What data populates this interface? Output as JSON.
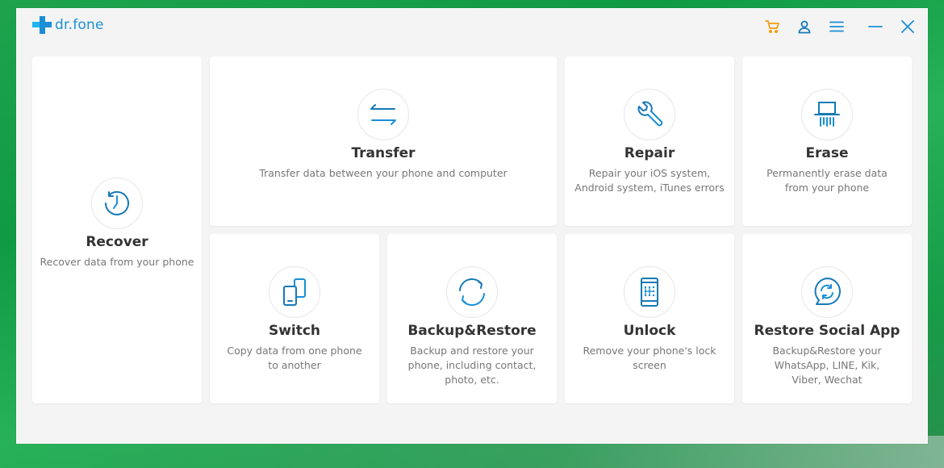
{
  "app": {
    "title": "dr.fone",
    "icons": [
      "cart-icon",
      "user-icon",
      "menu-icon",
      "minimize-icon",
      "close-icon"
    ],
    "colors": {
      "brand": "#1a8fd6",
      "cart": "#f39c12",
      "accent": "#1679b8"
    }
  },
  "modules": {
    "recover": {
      "title": "Recover",
      "desc": "Recover data from your phone",
      "icon": "clock-icon"
    },
    "transfer": {
      "title": "Transfer",
      "desc": "Transfer data between your phone and computer",
      "icon": "transfer-arrows-icon"
    },
    "repair": {
      "title": "Repair",
      "desc": "Repair your iOS system, Android system, iTunes errors",
      "icon": "wrench-icon"
    },
    "erase": {
      "title": "Erase",
      "desc": "Permanently erase data from your phone",
      "icon": "shredder-icon"
    },
    "switch": {
      "title": "Switch",
      "desc": "Copy data from one phone to another",
      "icon": "phone-switch-icon"
    },
    "backup": {
      "title": "Backup&Restore",
      "desc": "Backup and restore your phone, including contact, photo, etc.",
      "icon": "sync-icon"
    },
    "unlock": {
      "title": "Unlock",
      "desc": "Remove your phone's lock screen",
      "icon": "phone-lock-icon"
    },
    "social": {
      "title": "Restore Social App",
      "desc": "Backup&Restore your WhatsApp, LINE, Kik, Viber, Wechat",
      "icon": "chat-sync-icon"
    }
  }
}
